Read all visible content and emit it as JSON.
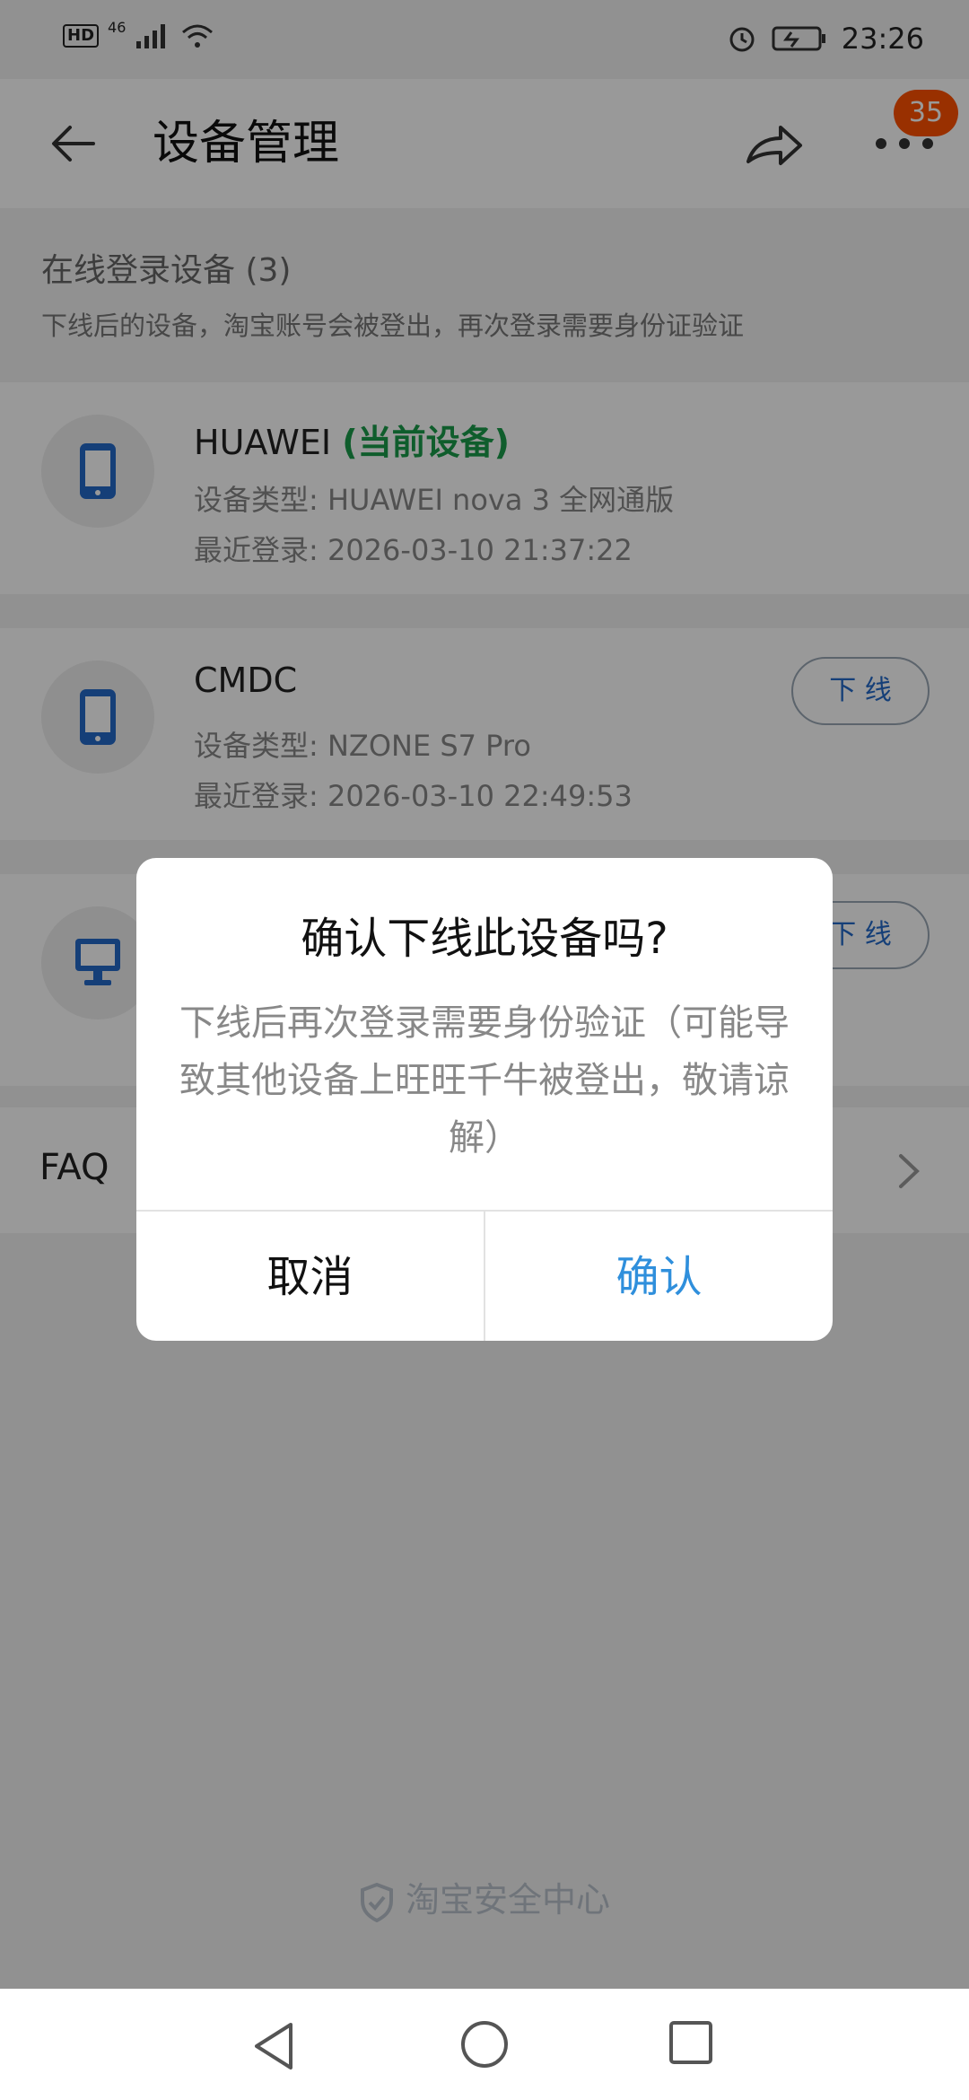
{
  "status_bar": {
    "hd": "HD",
    "network": "46",
    "time": "23:26",
    "icons": [
      "signal-icon",
      "wifi-icon",
      "alarm-icon",
      "battery-icon"
    ]
  },
  "header": {
    "title": "设备管理",
    "badge_count": "35",
    "icons": [
      "back-arrow-icon",
      "share-icon",
      "more-icon"
    ]
  },
  "section": {
    "title": "在线登录设备 (3)",
    "subtitle": "下线后的设备，淘宝账号会被登出，再次登录需要身份证验证"
  },
  "devices": [
    {
      "name": "HUAWEI",
      "current_tag": "(当前设备)",
      "type": "设备类型: HUAWEI nova 3 全网通版",
      "login": "最近登录: 2026-03-10 21:37:22",
      "icon": "phone-icon"
    },
    {
      "name": "CMDC",
      "type": "设备类型: NZONE S7 Pro",
      "login": "最近登录: 2026-03-10 22:49:53",
      "action": "下 线",
      "icon": "phone-icon"
    },
    {
      "action": "下 线",
      "icon": "monitor-icon"
    }
  ],
  "faq": {
    "label": "FAQ"
  },
  "footer": {
    "brand": "淘宝安全中心"
  },
  "dialog": {
    "title": "确认下线此设备吗?",
    "message": "下线后再次登录需要身份验证（可能导致其他设备上旺旺千牛被登出，敬请谅解）",
    "cancel": "取消",
    "confirm": "确认"
  },
  "colors": {
    "accent": "#2f8fdc",
    "current": "#1a9c4a",
    "badge": "#ff5000",
    "device_icon": "#2369c8"
  }
}
